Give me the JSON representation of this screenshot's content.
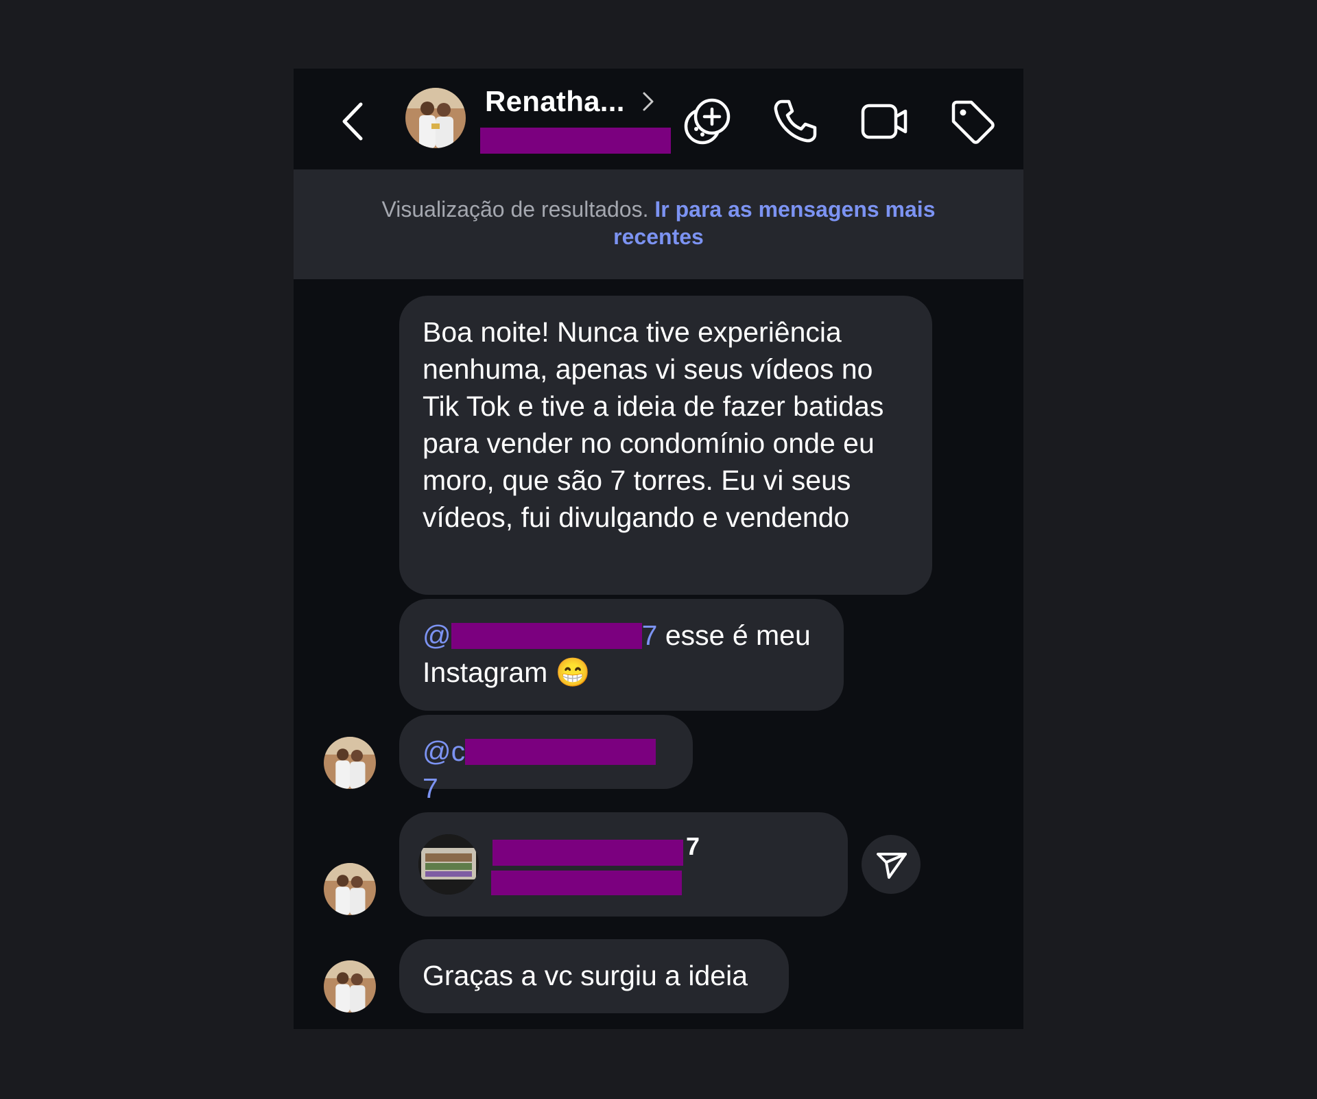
{
  "header": {
    "contact_name": "Renatha...",
    "back_icon": "chevron-left-icon",
    "name_chevron_icon": "chevron-right-icon",
    "actions": [
      {
        "name": "add-effects-icon"
      },
      {
        "name": "phone-icon"
      },
      {
        "name": "video-call-icon"
      },
      {
        "name": "tag-icon"
      }
    ]
  },
  "banner": {
    "text": "Visualização de resultados.",
    "link": "Ir para as mensagens mais recentes"
  },
  "messages": [
    {
      "text": "Boa noite! Nunca tive experiência nenhuma, apenas vi seus vídeos no Tik Tok e tive a ideia de fazer batidas para vender no condomínio onde eu moro, que são 7 torres. Eu vi seus vídeos, fui divulgando e vendendo"
    },
    {
      "mention_prefix": "@",
      "mention_suffix": "7",
      "text": " esse é meu Instagram",
      "emoji": "😁"
    },
    {
      "mention_prefix": "@c",
      "mention_suffix": "7"
    },
    {
      "profile_suffix": "7",
      "share_icon": "send-icon"
    },
    {
      "text": "Graças a vc surgiu a ideia"
    }
  ],
  "colors": {
    "background": "#0c0e12",
    "bubble": "#25272d",
    "accent": "#7c93f2",
    "redaction": "#7b007f"
  }
}
